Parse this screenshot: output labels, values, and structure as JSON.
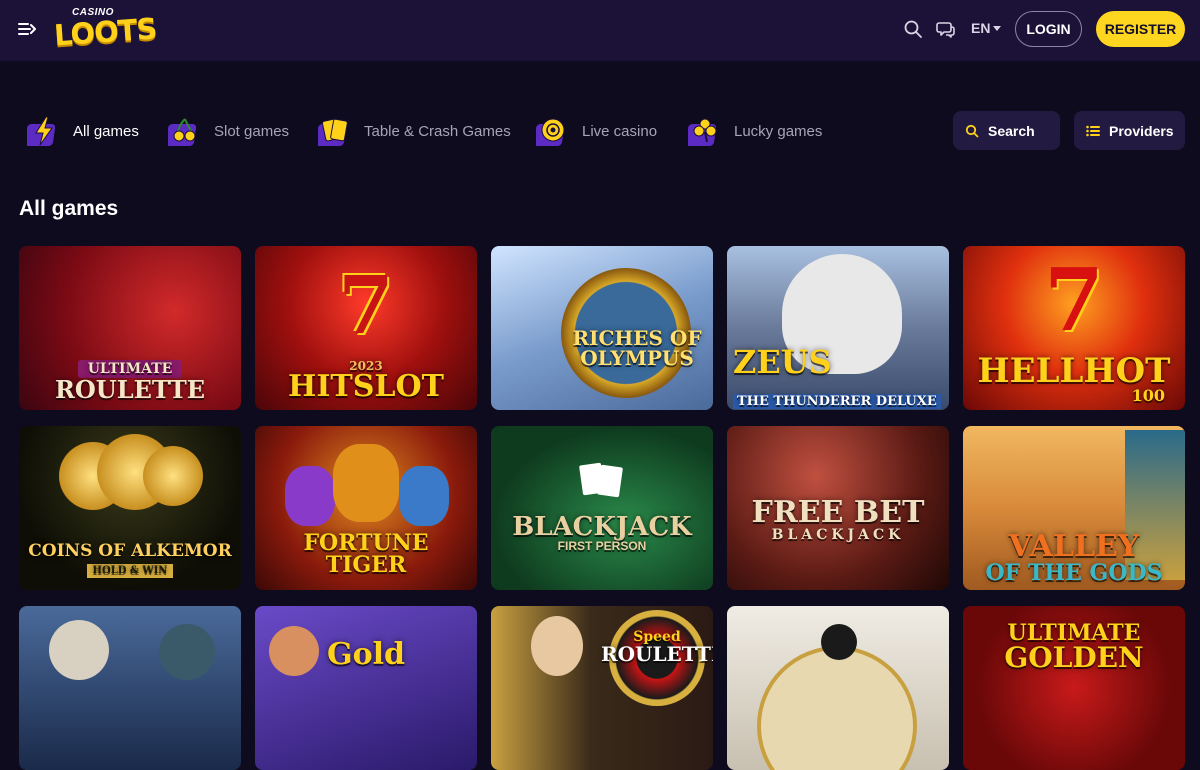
{
  "header": {
    "logo_small": "CASINO",
    "logo_big": "LOOTS",
    "lang": "EN",
    "login_label": "LOGIN",
    "register_label": "REGISTER"
  },
  "categories": [
    {
      "label": "All games",
      "icon": "lightning-icon",
      "active": true
    },
    {
      "label": "Slot games",
      "icon": "cherries-icon",
      "active": false
    },
    {
      "label": "Table & Crash Games",
      "icon": "cards-icon",
      "active": false
    },
    {
      "label": "Live casino",
      "icon": "chip-icon",
      "active": false
    },
    {
      "label": "Lucky games",
      "icon": "clover-icon",
      "active": false
    }
  ],
  "search_label": "Search",
  "providers_label": "Providers",
  "section_title": "All games",
  "games": [
    {
      "line1": "ULTIMATE",
      "line2": "ROULETTE",
      "bg": "#9b1020"
    },
    {
      "line1": "2023",
      "line2": "HITSLOT",
      "bg": "#8a0d12"
    },
    {
      "line1": "RICHES OF",
      "line2": "OLYMPUS",
      "bg": "#6b88b8"
    },
    {
      "line1": "ZEUS",
      "line2": "THE THUNDERER DELUXE",
      "bg": "#5a6d8e"
    },
    {
      "line1": "HELLHOT",
      "line2": "100",
      "bg": "#b0160e"
    },
    {
      "line1": "COINS OF ALKEMOR",
      "line2": "HOLD & WIN",
      "bg": "#2a2a10"
    },
    {
      "line1": "FORTUNE",
      "line2": "TIGER",
      "bg": "#8a1a0c"
    },
    {
      "line1": "BLACKJACK",
      "line2": "FIRST PERSON",
      "bg": "#1f5a3a"
    },
    {
      "line1": "FREE BET",
      "line2": "BLACKJACK",
      "bg": "#4a1a14"
    },
    {
      "line1": "VALLEY",
      "line2": "OF THE GODS",
      "bg": "#d88a3a"
    },
    {
      "line1": "",
      "line2": "",
      "bg": "#2a3a5a"
    },
    {
      "line1": "Gold",
      "line2": "",
      "bg": "#3a2a6a"
    },
    {
      "line1": "Speed",
      "line2": "ROULETTE",
      "bg": "#c8a040"
    },
    {
      "line1": "",
      "line2": "",
      "bg": "#d8d0c0"
    },
    {
      "line1": "ULTIMATE",
      "line2": "GOLDEN",
      "bg": "#8a1010"
    }
  ]
}
